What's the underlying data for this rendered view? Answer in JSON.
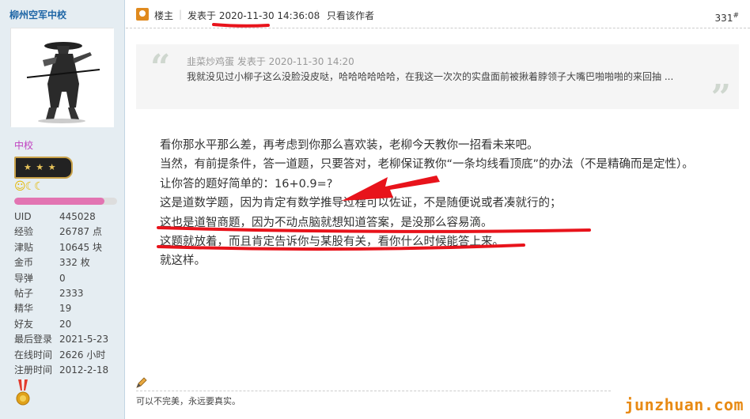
{
  "sidebar": {
    "username": "柳州空军中校",
    "rank_title": "中校",
    "level_icons": "☺☾☾",
    "progress": 0.88,
    "stats": [
      {
        "label": "UID",
        "value": "445028"
      },
      {
        "label": "经验",
        "value": "26787 点"
      },
      {
        "label": "津贴",
        "value": "10645 块"
      },
      {
        "label": "金币",
        "value": "332 枚"
      },
      {
        "label": "导弹",
        "value": "0"
      },
      {
        "label": "帖子",
        "value": "2333"
      },
      {
        "label": "精华",
        "value": "19"
      },
      {
        "label": "好友",
        "value": "20"
      },
      {
        "label": "最后登录",
        "value": "2021-5-23"
      },
      {
        "label": "在线时间",
        "value": "2626 小时"
      },
      {
        "label": "注册时间",
        "value": "2012-2-18"
      }
    ]
  },
  "header": {
    "louzhu": "楼主",
    "sep": "|",
    "posted_prefix": "发表于",
    "posted_time": "2020-11-30 14:36:08",
    "only_author": "只看该作者",
    "floor": "331",
    "floor_sup": "#"
  },
  "quote": {
    "open_mark": "“",
    "close_mark": "”",
    "meta": "韭菜炒鸡蛋 发表于 2020-11-30 14:20",
    "text": "我就没见过小柳子这么没脸没皮哒，哈哈哈哈哈哈，在我这一次次的实盘面前被揪着脖领子大嘴巴啪啪啪的来回抽 ..."
  },
  "body": {
    "p1": "看你那水平那么差，再考虑到你那么喜欢装，老柳今天教你一招看未来吧。",
    "p2": "当然，有前提条件，答一道题，只要答对，老柳保证教你“一条均线看顶底”的办法（不是精确而是定性）。",
    "p3": "让你答的题好简单的：16+0.9=?",
    "p4": "这是道数学题，因为肯定有数学推导过程可以佐证，不是随便说或者凑就行的；",
    "p5": "这也是道智商题，因为不动点脑就想知道答案，是没那么容易滴。",
    "p6": "这题就放着，而且肯定告诉你与某股有关，看你什么时候能答上来。",
    "p7": "就这样。"
  },
  "signature": {
    "text": "可以不完美，永远要真实。"
  },
  "watermark": "junzhuan.com",
  "colors": {
    "sidebar_bg": "#e5edf2",
    "username": "#1f66a6",
    "rank": "#c040c0",
    "annotation_red": "#e8131b",
    "watermark": "#e88a14"
  }
}
